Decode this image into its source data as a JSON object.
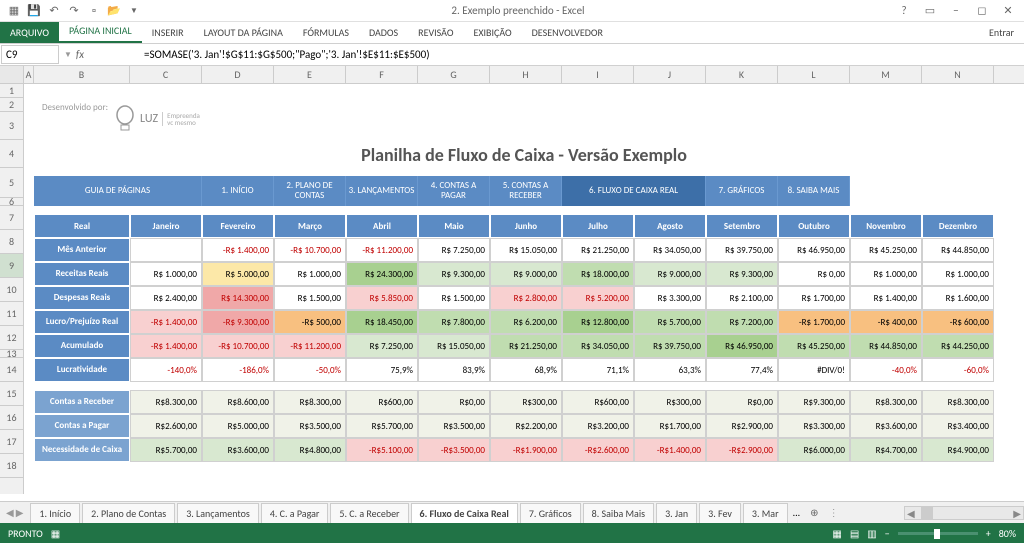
{
  "window": {
    "title": "2. Exemplo preenchido - Excel",
    "signin": "Entrar"
  },
  "ribbon": {
    "file": "ARQUIVO",
    "tabs": [
      "PÁGINA INICIAL",
      "INSERIR",
      "LAYOUT DA PÁGINA",
      "FÓRMULAS",
      "DADOS",
      "REVISÃO",
      "EXIBIÇÃO",
      "DESENVOLVEDOR"
    ]
  },
  "formula": {
    "cell": "C9",
    "text": "=SOMASE('3. Jan'!$G$11:$G$500;\"Pago\";'3. Jan'!$E$11:$E$500)"
  },
  "cols": [
    "A",
    "B",
    "C",
    "D",
    "E",
    "F",
    "G",
    "H",
    "I",
    "J",
    "K",
    "L",
    "M",
    "N"
  ],
  "rows": [
    "1",
    "2",
    "3",
    "4",
    "5",
    "6",
    "7",
    "8",
    "9",
    "10",
    "11",
    "12",
    "13",
    "14",
    "15",
    "16",
    "17",
    "18"
  ],
  "dev": "Desenvolvido por:",
  "brand": {
    "name": "LUZ",
    "tag": "Empreenda\nvc mesmo"
  },
  "main_title": "Planilha de Fluxo de Caixa - Versão Exemplo",
  "nav": [
    "GUIA DE PÁGINAS",
    "1. INÍCIO",
    "2. PLANO DE CONTAS",
    "3. LANÇAMENTOS",
    "4. CONTAS A PAGAR",
    "5. CONTAS A RECEBER",
    "6. FLUXO DE CAIXA REAL",
    "7. GRÁFICOS",
    "8. SAIBA MAIS"
  ],
  "nav_widths": [
    168,
    72,
    72,
    72,
    72,
    72,
    144,
    72,
    72
  ],
  "months_hdr": [
    "Real",
    "Janeiro",
    "Fevereiro",
    "Março",
    "Abril",
    "Maio",
    "Junho",
    "Julho",
    "Agosto",
    "Setembro",
    "Outubro",
    "Novembro",
    "Dezembro"
  ],
  "block1": {
    "rows": [
      {
        "label": "Mês Anterior",
        "vals": [
          "",
          "-R$ 1.400,00",
          "-R$ 10.700,00",
          "-R$ 11.200,00",
          "R$ 7.250,00",
          "R$ 15.050,00",
          "R$ 21.250,00",
          "R$ 34.050,00",
          "R$ 39.750,00",
          "R$ 46.950,00",
          "R$ 45.250,00",
          "R$ 44.850,00"
        ],
        "cls": [
          "",
          "",
          "",
          "",
          "",
          "",
          "",
          "",
          "",
          "",
          "",
          ""
        ]
      },
      {
        "label": "Receitas Reais",
        "vals": [
          "R$ 1.000,00",
          "R$ 5.000,00",
          "R$ 1.000,00",
          "R$ 24.300,00",
          "R$ 9.300,00",
          "R$ 9.000,00",
          "R$ 18.000,00",
          "R$ 9.000,00",
          "R$ 9.300,00",
          "R$ 0,00",
          "R$ 1.000,00",
          "R$ 1.000,00"
        ],
        "cls": [
          "",
          "y",
          "",
          "g3",
          "g1",
          "g1",
          "g2",
          "g1",
          "g1",
          "",
          "",
          ""
        ]
      },
      {
        "label": "Despesas Reais",
        "vals": [
          "R$ 2.400,00",
          "R$ 14.300,00",
          "R$ 1.500,00",
          "R$ 5.850,00",
          "R$ 1.500,00",
          "R$ 2.800,00",
          "R$ 5.200,00",
          "R$ 3.300,00",
          "R$ 2.100,00",
          "R$ 1.700,00",
          "R$ 1.400,00",
          "R$ 1.600,00"
        ],
        "cls": [
          "",
          "r2",
          "",
          "r1",
          "",
          "r1",
          "r1",
          "",
          "",
          "",
          "",
          ""
        ]
      },
      {
        "label": "Lucro/Prejuízo Real",
        "vals": [
          "-R$ 1.400,00",
          "-R$ 9.300,00",
          "-R$ 500,00",
          "R$ 18.450,00",
          "R$ 7.800,00",
          "R$ 6.200,00",
          "R$ 12.800,00",
          "R$ 5.700,00",
          "R$ 7.200,00",
          "-R$ 1.700,00",
          "-R$ 400,00",
          "-R$ 600,00"
        ],
        "cls": [
          "r1",
          "r2",
          "o",
          "g3",
          "g2",
          "g2",
          "g3",
          "g2",
          "g2",
          "o",
          "o",
          "o"
        ]
      },
      {
        "label": "Acumulado",
        "vals": [
          "-R$ 1.400,00",
          "-R$ 10.700,00",
          "-R$ 11.200,00",
          "R$ 7.250,00",
          "R$ 15.050,00",
          "R$ 21.250,00",
          "R$ 34.050,00",
          "R$ 39.750,00",
          "R$ 46.950,00",
          "R$ 45.250,00",
          "R$ 44.850,00",
          "R$ 44.250,00"
        ],
        "cls": [
          "r1",
          "r1",
          "r1",
          "g1",
          "g1",
          "g2",
          "g2",
          "g2",
          "g3",
          "g2",
          "g2",
          "g2"
        ]
      },
      {
        "label": "Lucratividade",
        "vals": [
          "-140,0%",
          "-186,0%",
          "-50,0%",
          "75,9%",
          "83,9%",
          "68,9%",
          "71,1%",
          "63,3%",
          "77,4%",
          "#DIV/0!",
          "-40,0%",
          "-60,0%"
        ],
        "cls": [
          "",
          "",
          "",
          "",
          "",
          "",
          "",
          "",
          "",
          "",
          "",
          ""
        ]
      }
    ]
  },
  "block2": {
    "rows": [
      {
        "label": "Contas a Receber",
        "vals": [
          "R$8.300,00",
          "R$8.600,00",
          "R$8.300,00",
          "R$600,00",
          "R$0,00",
          "R$300,00",
          "R$600,00",
          "R$300,00",
          "R$0,00",
          "R$9.300,00",
          "R$8.300,00",
          "R$8.300,00"
        ],
        "cls": [
          "lg",
          "lg",
          "lg",
          "lg",
          "lg",
          "lg",
          "lg",
          "lg",
          "lg",
          "lg",
          "lg",
          "lg"
        ]
      },
      {
        "label": "Contas a Pagar",
        "vals": [
          "R$2.600,00",
          "R$5.000,00",
          "R$3.500,00",
          "R$5.700,00",
          "R$3.500,00",
          "R$2.200,00",
          "R$3.200,00",
          "R$1.700,00",
          "R$2.900,00",
          "R$3.300,00",
          "R$3.600,00",
          "R$3.400,00"
        ],
        "cls": [
          "lg",
          "lg",
          "lg",
          "lg",
          "lg",
          "lg",
          "lg",
          "lg",
          "lg",
          "lg",
          "lg",
          "lg"
        ]
      },
      {
        "label": "Necessidade de Caixa",
        "vals": [
          "R$5.700,00",
          "R$3.600,00",
          "R$4.800,00",
          "-R$5.100,00",
          "-R$3.500,00",
          "-R$1.900,00",
          "-R$2.600,00",
          "-R$1.400,00",
          "-R$2.900,00",
          "R$6.000,00",
          "R$4.700,00",
          "R$4.900,00"
        ],
        "cls": [
          "g1",
          "g1",
          "g1",
          "r1",
          "r1",
          "r1",
          "r1",
          "r1",
          "r1",
          "g1",
          "g1",
          "g1"
        ]
      }
    ]
  },
  "sheet_tabs": [
    "1. Início",
    "2. Plano de Contas",
    "3. Lançamentos",
    "4. C. a Pagar",
    "5. C. a Receber",
    "6. Fluxo de Caixa Real",
    "7. Gráficos",
    "8. Saiba Mais",
    "3. Jan",
    "3. Fev",
    "3. Mar"
  ],
  "active_sheet": 5,
  "status": {
    "ready": "PRONTO",
    "zoom": "80%"
  }
}
